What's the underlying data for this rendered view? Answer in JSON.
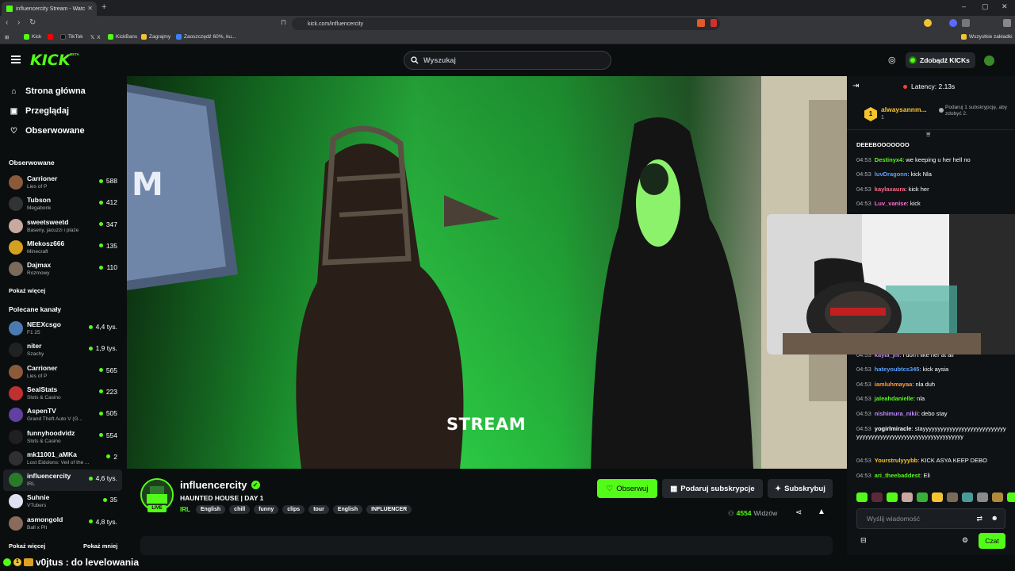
{
  "browser": {
    "tab_title": "influencercity Stream - Watc",
    "url": "kick.com/influencercity",
    "bookmarks": [
      {
        "label": "Kick",
        "color": "#53fc18"
      },
      {
        "label": "",
        "color": "#ff0000"
      },
      {
        "label": "TikTok",
        "color": "#111111"
      },
      {
        "label": "X",
        "color": "#ffffff"
      },
      {
        "label": "KickBans",
        "color": "#53fc18"
      },
      {
        "label": "Zagrajmy",
        "color": "#f4c430"
      },
      {
        "label": "Zaoszczędź 60%, ku...",
        "color": "#3b82f6"
      }
    ],
    "all_bookmarks": "Wszystkie zakładki"
  },
  "header": {
    "logo": "KICK",
    "beta": "BETA",
    "search_placeholder": "Wyszukaj",
    "kicks_button": "Zdobądź KICKs"
  },
  "sidebar": {
    "nav": [
      {
        "label": "Strona główna",
        "icon": "home-icon"
      },
      {
        "label": "Przeglądaj",
        "icon": "browse-icon"
      },
      {
        "label": "Obserwowane",
        "icon": "heart-icon"
      }
    ],
    "followed_title": "Obserwowane",
    "followed": [
      {
        "name": "Carrioner",
        "category": "Lies of P",
        "viewers": "588",
        "color": "#8a5a3a"
      },
      {
        "name": "Tubson",
        "category": "Megabonk",
        "viewers": "412",
        "color": "#333333"
      },
      {
        "name": "sweetsweetd",
        "category": "Baseny, jacuzzi i plaże",
        "viewers": "347",
        "color": "#c9a8a0"
      },
      {
        "name": "Mlekosz666",
        "category": "Minecraft",
        "viewers": "135",
        "color": "#d4a020"
      },
      {
        "name": "Dajmax",
        "category": "Rozmowy",
        "viewers": "110",
        "color": "#7a6a5a"
      }
    ],
    "show_more_1": "Pokaż więcej",
    "recommended_title": "Polecane kanały",
    "recommended": [
      {
        "name": "NEEXcsgo",
        "category": "F1 25",
        "viewers": "4,4 tys.",
        "color": "#4a7ab0"
      },
      {
        "name": "niter",
        "category": "Szachy",
        "viewers": "1,9 tys.",
        "color": "#222222"
      },
      {
        "name": "Carrioner",
        "category": "Lies of P",
        "viewers": "565",
        "color": "#8a5a3a"
      },
      {
        "name": "SealStats",
        "category": "Slots & Casino",
        "viewers": "223",
        "color": "#c03030"
      },
      {
        "name": "AspenTV",
        "category": "Grand Theft Auto V (G...",
        "viewers": "505",
        "color": "#6040a0"
      },
      {
        "name": "funnyhoodvidz",
        "category": "Slots & Casino",
        "viewers": "554",
        "color": "#202020"
      },
      {
        "name": "mk11001_aMKa",
        "category": "Lost Eidolons: Veil of the ...",
        "viewers": "2",
        "color": "#303030"
      },
      {
        "name": "influencercity",
        "category": "IRL",
        "viewers": "4,6 tys.",
        "color": "#2a7a2a",
        "active": true
      },
      {
        "name": "Suhnie",
        "category": "VTubers",
        "viewers": "35",
        "color": "#e0e0f0"
      },
      {
        "name": "asmongold",
        "category": "Ball x Pit",
        "viewers": "4,8 tys.",
        "color": "#8a6a5a"
      }
    ],
    "show_more_2": "Pokaż więcej",
    "show_less": "Pokaż mniej"
  },
  "video": {
    "overlay_text": "STREAM"
  },
  "channel": {
    "name": "influencercity",
    "avatar_text": "INFLUENCER CITY",
    "live": "LIVE",
    "title": "HAUNTED HOUSE | DAY 1",
    "category": "IRL",
    "tags": [
      "English",
      "chill",
      "funny",
      "clips",
      "tour",
      "English",
      "INFLUENCER"
    ],
    "follow_button": "Obserwuj",
    "gift_button": "Podaruj subskrypcje",
    "subscribe_button": "Subskrybuj",
    "viewers_count": "4554",
    "viewers_label": "Widzów"
  },
  "chat": {
    "latency": "Latency: 2.13s",
    "gift_user": "alwaysannm...",
    "gift_count": "1",
    "gift_note": "Podaruj 1 subskrypcję, aby zdobyć 2.",
    "messages": [
      {
        "time": "",
        "user": "",
        "text": "DEEEBOOOOOOO",
        "color": "#ffffff"
      },
      {
        "time": "04:53",
        "user": "Destinyx4",
        "text": "we keeping u her hell no",
        "color": "#53fc18"
      },
      {
        "time": "04:53",
        "user": "luvDragonn",
        "text": "kick Nla",
        "color": "#5aa0ff"
      },
      {
        "time": "04:53",
        "user": "kaylaxaura",
        "text": "kick her",
        "color": "#ff6b8a"
      },
      {
        "time": "04:53",
        "user": "Luv_vanise",
        "text": "kick",
        "color": "#ff6bd0"
      },
      {
        "time": "04:53",
        "user": "kayla_jm",
        "text": "i don't like her at all",
        "color": "#c08aff"
      },
      {
        "time": "04:53",
        "user": "hateyoubtcs345",
        "text": "kick aysia",
        "color": "#5aa0ff"
      },
      {
        "time": "04:53",
        "user": "iamluhmayaa",
        "text": "nla duh",
        "color": "#ff9a3c"
      },
      {
        "time": "04:53",
        "user": "jaleahdanielle",
        "text": "nla",
        "color": "#53fc18"
      },
      {
        "time": "04:53",
        "user": "nishimura_nikii",
        "text": "debo stay",
        "color": "#c08aff"
      },
      {
        "time": "04:53",
        "user": "yogirlmiracle",
        "text": "stayyyyyyyyyyyyyyyyyyyyyyyyyyyyyyyyyyyyyyyyyyyyyyyyyyyyyyyyyyyyyyyy",
        "color": "#ffffff"
      },
      {
        "time": "04:53",
        "user": "Yourstrulyyybb",
        "text": "KICK ASYA KEEP DEBO",
        "color": "#f4c430"
      },
      {
        "time": "04:53",
        "user": "ari_theebaddest",
        "text": "Eli",
        "color": "#53fc18"
      }
    ],
    "input_placeholder": "Wyślij wiadomość",
    "send_button": "Czat"
  },
  "overlay_bottom": {
    "badge": "1",
    "user": "v0jtus",
    "text": "do levelowania"
  }
}
